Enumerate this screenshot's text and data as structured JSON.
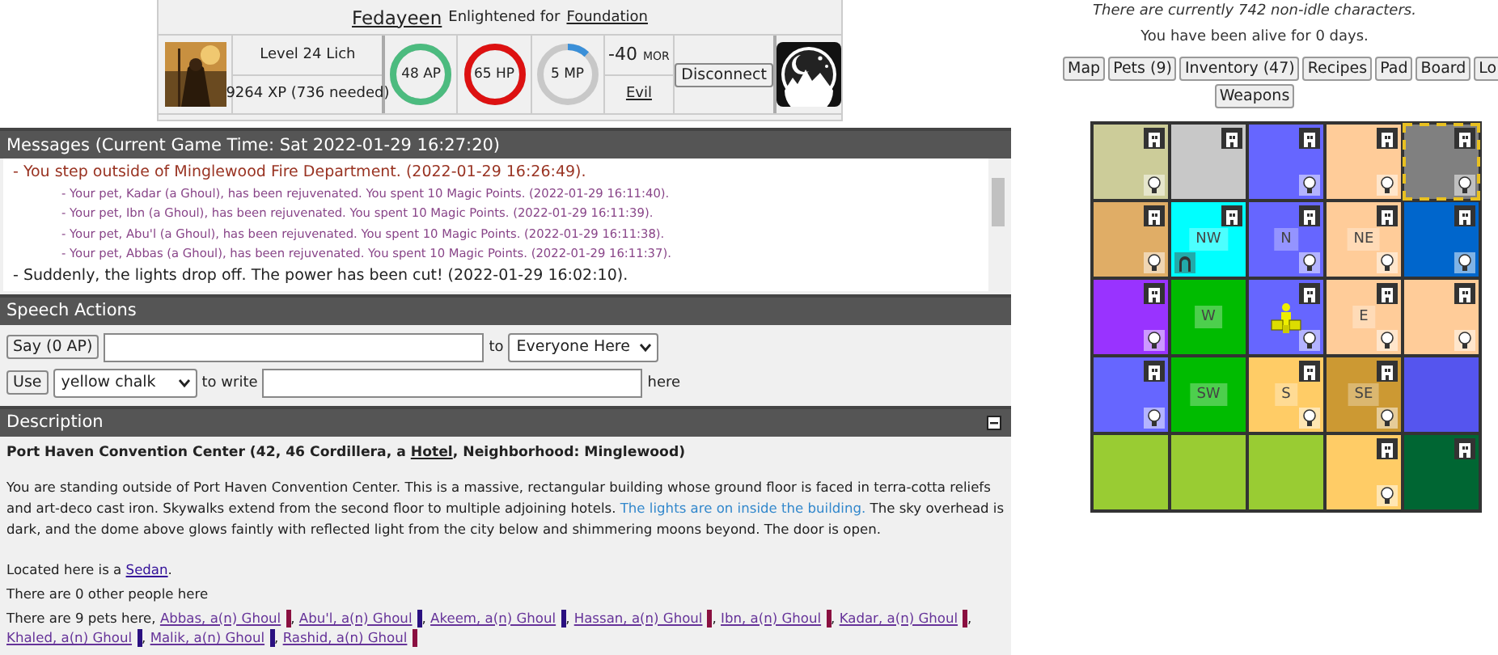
{
  "character": {
    "name": "Fedayeen",
    "title_text": "Enlightened for",
    "faction": "Foundation",
    "level_text": "Level 24 Lich",
    "xp_text": "9264 XP (736 needed)",
    "meters": [
      {
        "label": "48 AP",
        "level": 1,
        "color": "#4cbb7f"
      },
      {
        "label": "65 HP",
        "level": 1,
        "color": "#dd1111"
      },
      {
        "label": "5 MP",
        "level": 0.12,
        "color": "#3a8fd8"
      }
    ],
    "morality": {
      "value": "-40",
      "unit": "MOR",
      "alignment": "Evil"
    },
    "disconnect": "Disconnect"
  },
  "messages": {
    "title": "Messages (Current Game Time: Sat 2022-01-29 16:27:20)",
    "lines": [
      {
        "kind": "event",
        "text": "- You step outside of Minglewood Fire Department. (2022-01-29 16:26:49)."
      },
      {
        "kind": "pet",
        "text": "- Your pet, Kadar (a Ghoul), has been rejuvenated. You spent 10 Magic Points. (2022-01-29 16:11:40)."
      },
      {
        "kind": "pet",
        "text": "- Your pet, Ibn (a Ghoul), has been rejuvenated. You spent 10 Magic Points. (2022-01-29 16:11:39)."
      },
      {
        "kind": "pet",
        "text": "- Your pet, Abu'l (a Ghoul), has been rejuvenated. You spent 10 Magic Points. (2022-01-29 16:11:38)."
      },
      {
        "kind": "pet",
        "text": "- Your pet, Abbas (a Ghoul), has been rejuvenated. You spent 10 Magic Points. (2022-01-29 16:11:37)."
      },
      {
        "kind": "normal",
        "text": "- Suddenly, the lights drop off. The power has been cut! (2022-01-29 16:02:10)."
      }
    ]
  },
  "speech": {
    "title": "Speech Actions",
    "say_button": "Say (0 AP)",
    "to_text": "to",
    "target": "Everyone Here",
    "use_button": "Use",
    "item": "yellow chalk",
    "write_text": "to write",
    "here_text": "here"
  },
  "description": {
    "title": "Description",
    "location_parts": [
      "Port Haven Convention Center (42, 46 Cordillera, a ",
      "Hotel",
      ", Neighborhood: Minglewood)"
    ],
    "text_parts": [
      "You are standing outside of Port Haven Convention Center. This is a massive, rectangular building whose ground floor is faced in terra-cotta reliefs and art-deco cast iron. Skywalks extend from the second floor to multiple adjoining hotels. ",
      "The lights are on inside the building.",
      " The sky overhead is dark, and the dome above glows faintly with reflected light from the city below and shimmering moons beyond. The door is open."
    ],
    "located_text": "Located here is a",
    "located_item": "Sedan",
    "located_end": ".",
    "people_text": "There are 0 other people here",
    "pets_text": "There are 9 pets here,",
    "pets": [
      {
        "name": "Abbas, a(n) Ghoul",
        "color": "#8a1040",
        "separator": ","
      },
      {
        "name": "Abu'l, a(n) Ghoul",
        "color": "#2a1080",
        "separator": ","
      },
      {
        "name": "Akeem, a(n) Ghoul",
        "color": "#2a1080",
        "separator": ","
      },
      {
        "name": "Hassan, a(n) Ghoul",
        "color": "#8a1040",
        "separator": ","
      },
      {
        "name": "Ibn, a(n) Ghoul",
        "color": "#8a1040",
        "separator": ","
      },
      {
        "name": "Kadar, a(n) Ghoul",
        "color": "#8a1040",
        "separator": ","
      },
      {
        "name": "Khaled, a(n) Ghoul",
        "color": "#2a1080",
        "separator": ","
      },
      {
        "name": "Malik, a(n) Ghoul",
        "color": "#2a1080",
        "separator": ","
      },
      {
        "name": "Rashid, a(n) Ghoul",
        "color": "#8a1040"
      }
    ]
  },
  "status": {
    "characters_text": "There are currently 742 non-idle characters.",
    "alive_text": "You have been alive for 0 days."
  },
  "nav_rows": [
    [
      "Map",
      "Pets (9)",
      "Inventory (47)",
      "Recipes",
      "Pad",
      "Board",
      "Lo"
    ],
    [
      "Weapons"
    ]
  ],
  "map": {
    "rows": [
      [
        {
          "color": "#cccc99",
          "top_icon": true,
          "bulb": true,
          "selected": false
        },
        {
          "color": "#c8c8c8",
          "top_icon": true,
          "selected": false
        },
        {
          "color": "#6666ff",
          "top_icon": true,
          "bulb": true,
          "selected": false
        },
        {
          "color": "#ffcc99",
          "top_icon": true,
          "bulb": true,
          "selected": false
        },
        {
          "color": "#808080",
          "top_icon": true,
          "bulb": true,
          "selected": true
        }
      ],
      [
        {
          "color": "#e0ad66",
          "top_icon": true,
          "bulb": true,
          "selected": false
        },
        {
          "color": "#00ffff",
          "top_icon": true,
          "arch": true,
          "label": "NW",
          "selected": false
        },
        {
          "color": "#6666ff",
          "top_icon": true,
          "bulb": true,
          "label": "N",
          "selected": false
        },
        {
          "color": "#ffcc99",
          "top_icon": true,
          "bulb": true,
          "label": "NE",
          "selected": false
        },
        {
          "color": "#0066cc",
          "top_icon": true,
          "bulb": true,
          "selected": false
        }
      ],
      [
        {
          "color": "#9933ff",
          "top_icon": true,
          "bulb": true,
          "selected": false
        },
        {
          "color": "#00bb00",
          "label": "W",
          "selected": false
        },
        {
          "color": "#6666ff",
          "top_icon": true,
          "bulb": true,
          "player": true,
          "selected": false
        },
        {
          "color": "#ffcc99",
          "top_icon": true,
          "bulb": true,
          "label": "E",
          "selected": false
        },
        {
          "color": "#ffcc99",
          "top_icon": true,
          "bulb": true,
          "selected": false
        }
      ],
      [
        {
          "color": "#6666ff",
          "top_icon": true,
          "bulb": true,
          "selected": false
        },
        {
          "color": "#00bb00",
          "label": "SW",
          "selected": false
        },
        {
          "color": "#ffcc66",
          "top_icon": true,
          "bulb": true,
          "label": "S",
          "selected": false
        },
        {
          "color": "#cc9933",
          "top_icon": true,
          "bulb": true,
          "label": "SE",
          "selected": false
        },
        {
          "color": "#5555ee",
          "selected": false
        }
      ],
      [
        {
          "color": "#99cc33",
          "selected": false
        },
        {
          "color": "#99cc33",
          "selected": false
        },
        {
          "color": "#99cc33",
          "selected": false
        },
        {
          "color": "#ffcc66",
          "top_icon": true,
          "bulb": true,
          "selected": false
        },
        {
          "color": "#006633",
          "top_icon": true,
          "selected": false
        }
      ]
    ]
  }
}
